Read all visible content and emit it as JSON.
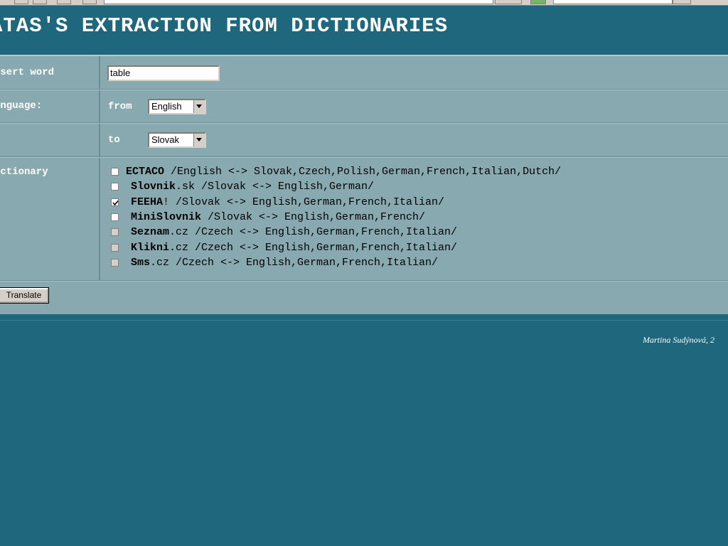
{
  "page": {
    "title": "ATAS'S EXTRACTION FROM DICTIONARIES"
  },
  "form": {
    "insert_word_label": "nsert word",
    "word_value": "table",
    "language_label": "anguage:",
    "from_label": "from",
    "from_value": "English",
    "to_label": "to",
    "to_value": "Slovak",
    "dictionary_label": "ictionary",
    "translate_label": "Translate"
  },
  "dictionaries": [
    {
      "name": "ECTACO",
      "name_rest": "",
      "langs": "/English <-> Slovak,Czech,Polish,German,French,Italian,Dutch/",
      "checked": false,
      "enabled": true
    },
    {
      "name": "Slovnik",
      "name_rest": ".sk",
      "langs": "/Slovak <-> English,German/",
      "checked": false,
      "enabled": true
    },
    {
      "name": "FEEHA",
      "name_rest": "!",
      "langs": "/Slovak <-> English,German,French,Italian/",
      "checked": true,
      "enabled": true
    },
    {
      "name": "MiniSlovnik",
      "name_rest": "",
      "langs": "/Slovak <-> English,German,French/",
      "checked": false,
      "enabled": true
    },
    {
      "name": "Seznam",
      "name_rest": ".cz",
      "langs": "/Czech <-> English,German,French,Italian/",
      "checked": false,
      "enabled": false
    },
    {
      "name": "Klikni",
      "name_rest": ".cz",
      "langs": "/Czech <-> English,German,French,Italian/",
      "checked": false,
      "enabled": false
    },
    {
      "name": "Sms",
      "name_rest": ".cz",
      "langs": "/Czech <-> English,German,French,Italian/",
      "checked": false,
      "enabled": false
    }
  ],
  "footer": {
    "author": "Martina Sudýnová, 2"
  },
  "colors": {
    "page_bg": "#1e677c",
    "form_bg": "#89a9b0"
  }
}
